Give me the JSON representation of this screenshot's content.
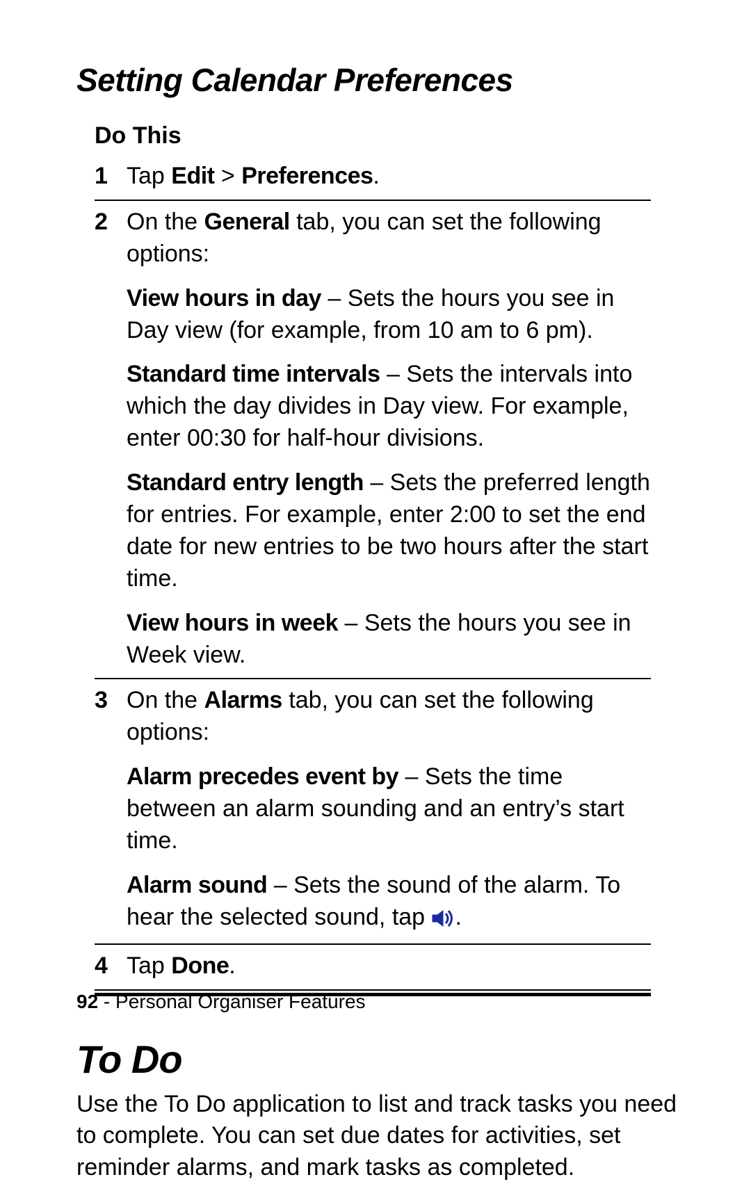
{
  "h2": "Setting Calendar Preferences",
  "table_head": "Do This",
  "steps": {
    "s1": {
      "num": "1",
      "line1_pre": "Tap ",
      "edit": "Edit",
      "gt": " > ",
      "prefs": "Preferences",
      "period": "."
    },
    "s2": {
      "num": "2",
      "intro_pre": "On the ",
      "general": "General",
      "intro_post": " tab, you can set the following options:",
      "opt1_label": "View hours in day",
      "opt1_text": " – Sets the hours you see in Day view (for example, from 10 am to 6 pm).",
      "opt2_label": "Standard time intervals",
      "opt2_text": " – Sets the intervals into which the day divides in Day view. For example, enter 00:30 for half-hour divisions.",
      "opt3_label": "Standard entry length",
      "opt3_text": " – Sets the preferred length for entries. For example, enter 2:00 to set the end date for new entries to be two hours after the start time.",
      "opt4_label": "View hours in week",
      "opt4_text": " – Sets the hours you see in Week view."
    },
    "s3": {
      "num": "3",
      "intro_pre": "On the ",
      "alarms": "Alarms",
      "intro_post": " tab, you can set the following options:",
      "opt1_label": "Alarm precedes event by",
      "opt1_text": " – Sets the time between an alarm sounding and an entry’s start time.",
      "opt2_label": "Alarm sound",
      "opt2_text_a": " – Sets the sound of the alarm. To hear the selected sound, tap ",
      "opt2_text_b": "."
    },
    "s4": {
      "num": "4",
      "pre": "Tap ",
      "done": "Done",
      "period": "."
    }
  },
  "h1": "To Do",
  "todo_para": "Use the To Do application to list and track tasks you need to complete. You can set due dates for activities, set reminder alarms, and mark tasks as completed.",
  "footer": {
    "page": "92",
    "sep": " - ",
    "section": "Personal Organiser Features"
  }
}
